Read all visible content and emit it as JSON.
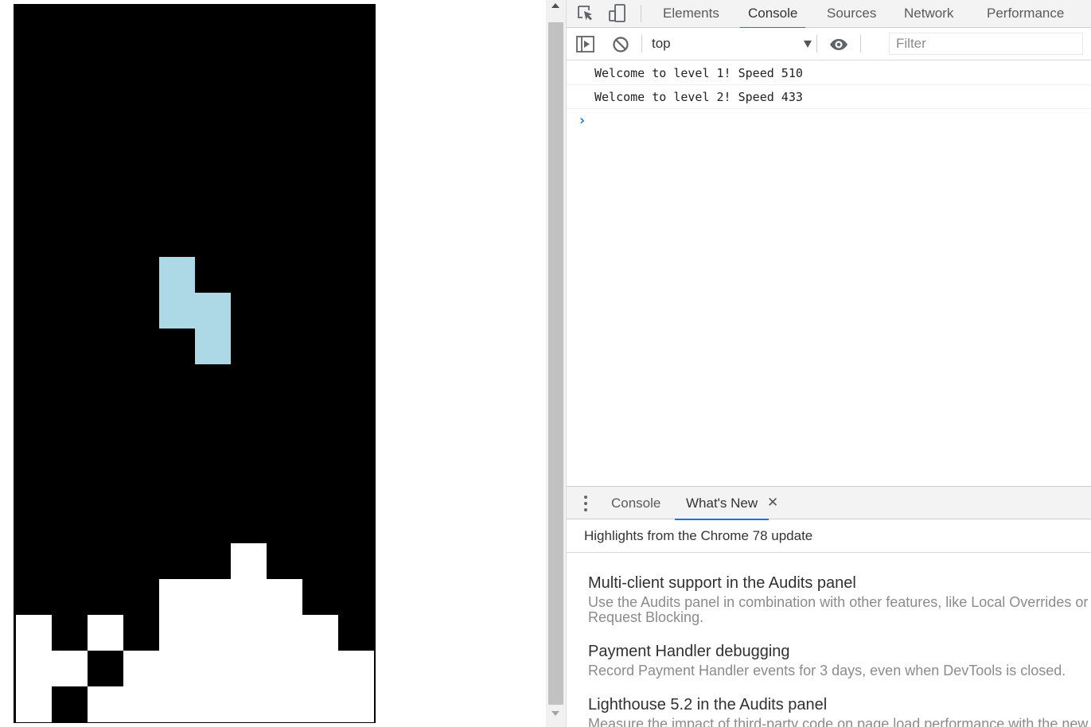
{
  "board": {
    "background": "#000000",
    "locked_color": "#ffffff",
    "active_color": "#add8e6",
    "cols": 10,
    "rows": 20,
    "active_piece": {
      "type": "S",
      "cells": [
        [
          4,
          7
        ],
        [
          4,
          8
        ],
        [
          5,
          8
        ],
        [
          5,
          9
        ]
      ]
    },
    "locked_cells": [
      [
        6,
        15
      ],
      [
        4,
        16
      ],
      [
        5,
        16
      ],
      [
        6,
        16
      ],
      [
        7,
        16
      ],
      [
        0,
        17
      ],
      [
        2,
        17
      ],
      [
        4,
        17
      ],
      [
        5,
        17
      ],
      [
        6,
        17
      ],
      [
        7,
        17
      ],
      [
        8,
        17
      ],
      [
        0,
        18
      ],
      [
        1,
        18
      ],
      [
        3,
        18
      ],
      [
        4,
        18
      ],
      [
        5,
        18
      ],
      [
        6,
        18
      ],
      [
        7,
        18
      ],
      [
        8,
        18
      ],
      [
        9,
        18
      ],
      [
        0,
        19
      ],
      [
        2,
        19
      ],
      [
        3,
        19
      ],
      [
        4,
        19
      ],
      [
        5,
        19
      ],
      [
        6,
        19
      ],
      [
        7,
        19
      ],
      [
        8,
        19
      ],
      [
        9,
        19
      ]
    ]
  },
  "devtools": {
    "toolbar": {
      "inspect_icon": "inspect-element-icon",
      "device_icon": "device-toolbar-icon",
      "tabs": [
        {
          "label": "Elements",
          "active": false
        },
        {
          "label": "Console",
          "active": true
        },
        {
          "label": "Sources",
          "active": false
        },
        {
          "label": "Network",
          "active": false
        },
        {
          "label": "Performance",
          "active": false
        }
      ]
    },
    "console_bar": {
      "sidebar_icon": "show-sidebar-icon",
      "clear_icon": "clear-console-icon",
      "context": "top",
      "eye_icon": "live-expression-icon",
      "filter_placeholder": "Filter"
    },
    "console": {
      "messages": [
        "Welcome to level 1! Speed 510",
        "Welcome to level 2! Speed 433"
      ],
      "prompt": "›"
    },
    "drawer": {
      "tabs": [
        {
          "label": "Console",
          "active": false
        },
        {
          "label": "What's New",
          "active": true
        }
      ],
      "close_glyph": "✕",
      "header": "Highlights from the Chrome 78 update",
      "items": [
        {
          "title": "Multi-client support in the Audits panel",
          "desc": "Use the Audits panel in combination with other features, like Local Overrides or Request Blocking."
        },
        {
          "title": "Payment Handler debugging",
          "desc": "Record Payment Handler events for 3 days, even when DevTools is closed."
        },
        {
          "title": "Lighthouse 5.2 in the Audits panel",
          "desc": "Measure the impact of third-party code on page load performance with the new"
        }
      ]
    },
    "accent_color": "#1a73e8"
  }
}
